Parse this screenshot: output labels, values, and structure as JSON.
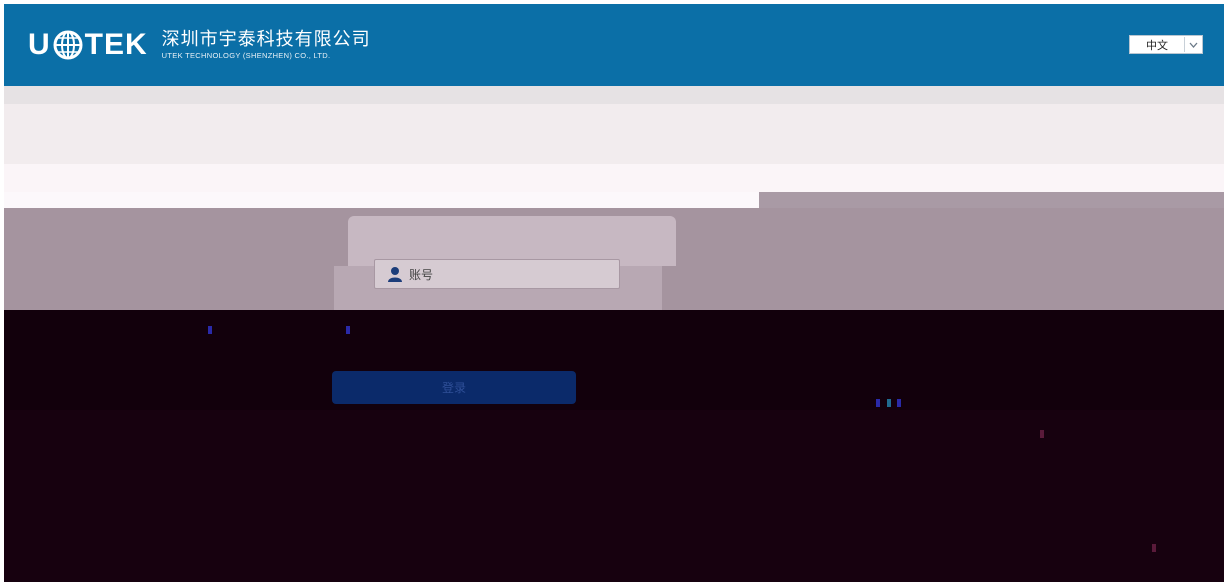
{
  "header": {
    "logo_text": "U",
    "logo_text_end": "TEK",
    "company_cn": "深圳市宇泰科技有限公司",
    "company_en": "UTEK TECHNOLOGY (SHENZHEN) CO., LTD.",
    "language": {
      "selected": "中文"
    }
  },
  "login": {
    "account_placeholder": "账号",
    "login_button": "登录"
  },
  "colors": {
    "header_bg": "#0b6fa7",
    "button_bg": "#0b2a6a"
  }
}
